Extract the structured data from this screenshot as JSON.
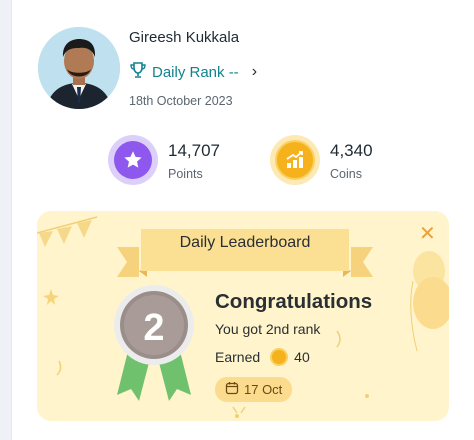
{
  "user": {
    "name": "Gireesh Kukkala",
    "daily_rank_label": "Daily Rank --",
    "date": "18th October 2023"
  },
  "stats": {
    "points": {
      "value": "14,707",
      "label": "Points"
    },
    "coins": {
      "value": "4,340",
      "label": "Coins"
    }
  },
  "leaderboard": {
    "title": "Daily Leaderboard",
    "congrats": "Congratulations",
    "rank_text": "You got 2nd rank",
    "medal_number": "2",
    "earned_label": "Earned",
    "earned_value": "40",
    "date_chip": "17 Oct"
  },
  "icons": {
    "trophy": "trophy-icon",
    "chevron": "chevron-right-icon",
    "points": "star-icon",
    "coins": "growth-chart-icon",
    "close": "close-icon",
    "calendar": "calendar-icon",
    "coin": "coin-icon"
  },
  "colors": {
    "accent_teal": "#11838e",
    "points_purple": "#8e57ee",
    "coin_gold": "#f5b21c",
    "card_bg": "#fff4cc"
  }
}
